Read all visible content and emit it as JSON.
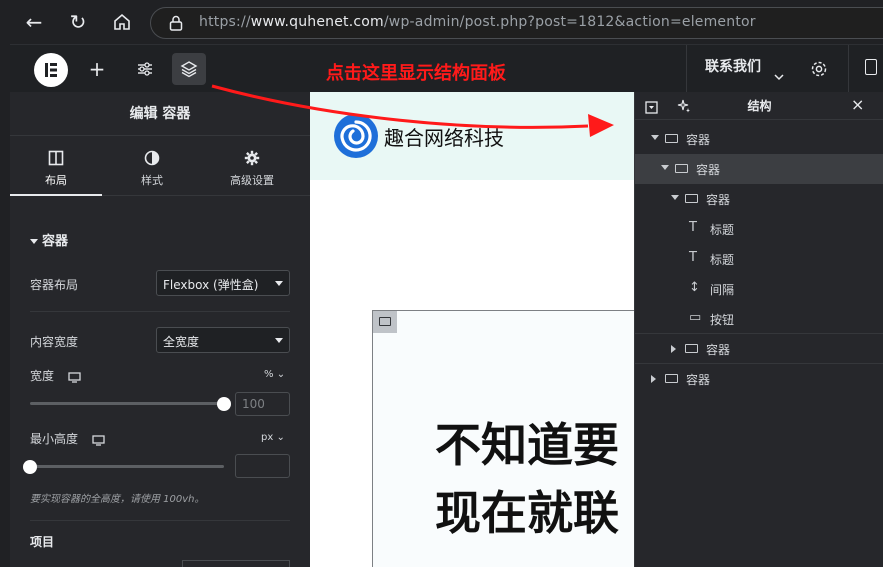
{
  "browser": {
    "url_prefix": "https://",
    "url_domain": "www.quhenet.com",
    "url_path": "/wp-admin/post.php?post=1812&action=elementor"
  },
  "toolbar": {
    "annotation": "点击这里显示结构面板",
    "contact_menu": "联系我们"
  },
  "panel": {
    "title": "编辑 容器",
    "tabs": [
      {
        "label": "布局",
        "icon": "layout-icon",
        "active": true
      },
      {
        "label": "样式",
        "icon": "style-icon",
        "active": false
      },
      {
        "label": "高级设置",
        "icon": "gear-icon",
        "active": false
      }
    ],
    "section_title": "容器",
    "container_layout": {
      "label": "容器布局",
      "value": "Flexbox (弹性盒)"
    },
    "content_width": {
      "label": "内容宽度",
      "value": "全宽度"
    },
    "width": {
      "label": "宽度",
      "unit": "%",
      "value": "100",
      "slider_fraction": 1.0
    },
    "min_height": {
      "label": "最小高度",
      "unit": "px",
      "value": "",
      "slider_fraction": 0.0
    },
    "hint": "要实现容器的全高度，请使用 100vh。",
    "items_label": "项目"
  },
  "canvas": {
    "site_name": "趣合网络科技",
    "headline_line1": "不知道要",
    "headline_line2": "现在就联"
  },
  "navigator": {
    "title": "结构",
    "rows": [
      {
        "label": "容器",
        "type": "container",
        "level": 0,
        "toggle": "down",
        "selected": false
      },
      {
        "label": "容器",
        "type": "container",
        "level": 1,
        "toggle": "down",
        "selected": true
      },
      {
        "label": "容器",
        "type": "container",
        "level": 2,
        "toggle": "down",
        "selected": false
      },
      {
        "label": "标题",
        "type": "heading",
        "level": 3,
        "toggle": "",
        "selected": false
      },
      {
        "label": "标题",
        "type": "heading",
        "level": 3,
        "toggle": "",
        "selected": false
      },
      {
        "label": "间隔",
        "type": "spacer",
        "level": 3,
        "toggle": "",
        "selected": false
      },
      {
        "label": "按钮",
        "type": "button",
        "level": 3,
        "toggle": "",
        "selected": false
      },
      {
        "label": "容器",
        "type": "container",
        "level": 2,
        "toggle": "right",
        "selected": false
      },
      {
        "label": "容器",
        "type": "container",
        "level": 0,
        "toggle": "right",
        "selected": false
      }
    ]
  },
  "colors": {
    "annotation_red": "#ff1a1a",
    "header_bg": "#e9f8f5",
    "logo_blue": "#1e6fd9"
  }
}
